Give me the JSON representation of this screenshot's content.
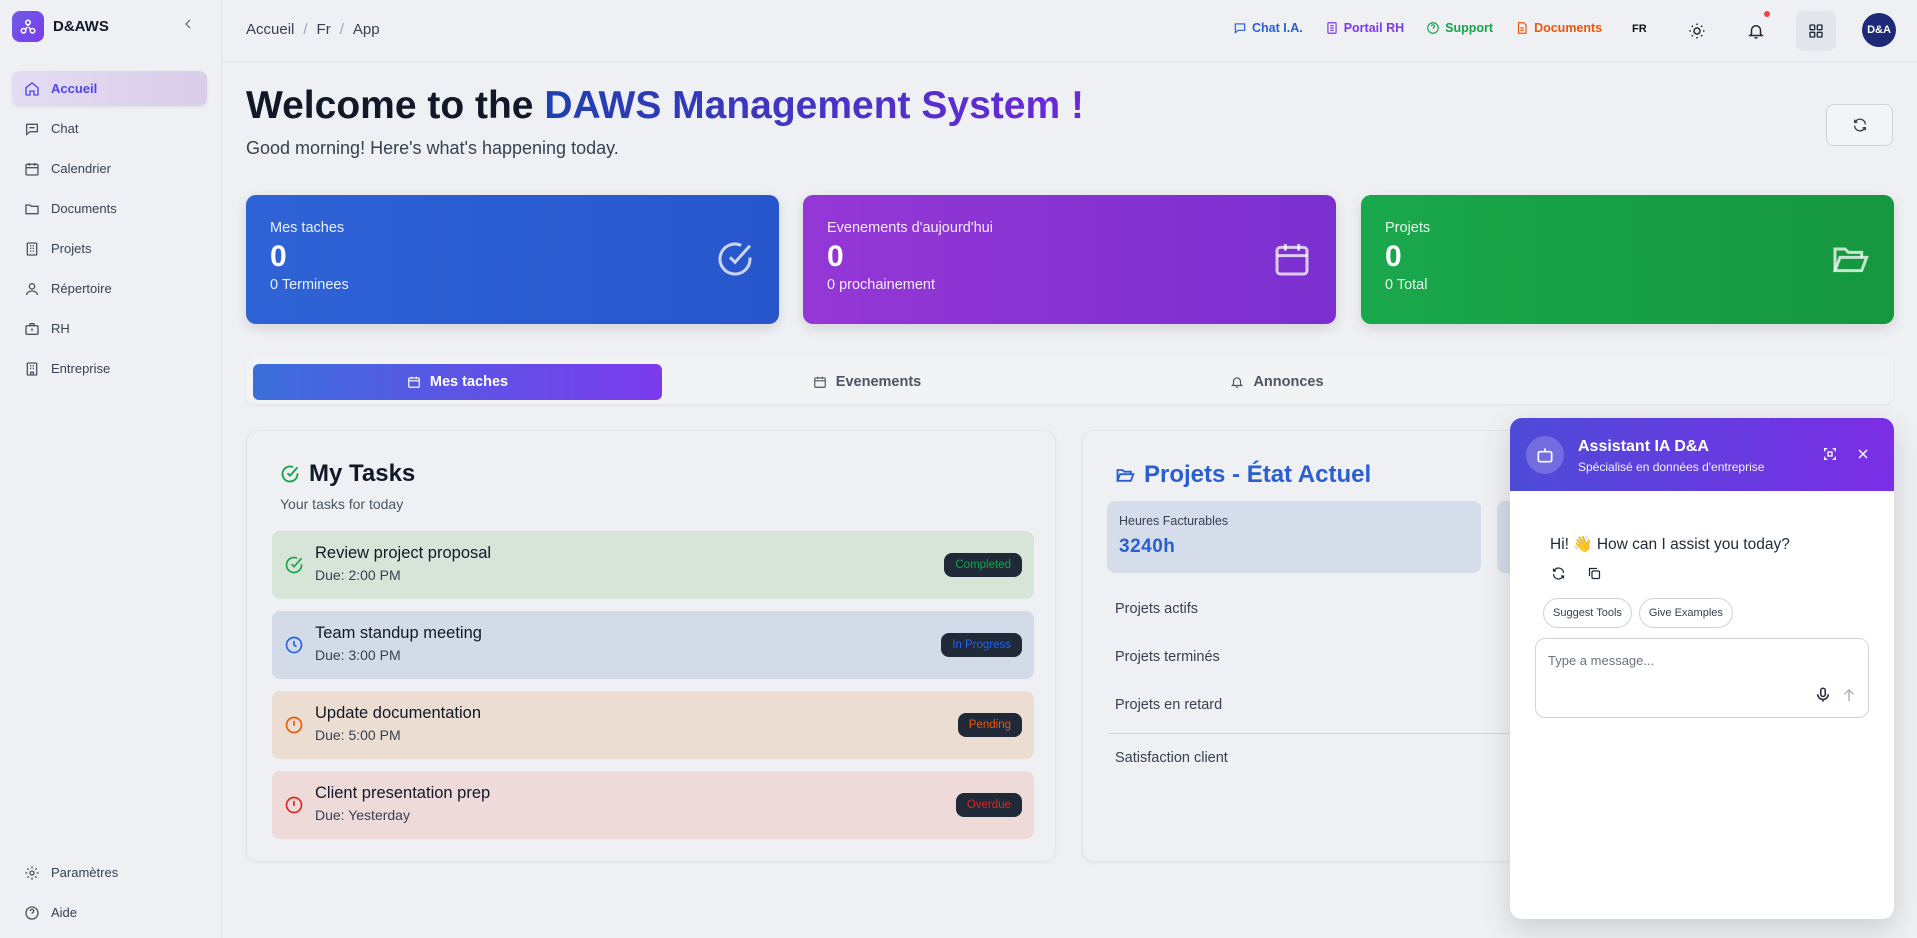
{
  "brand": {
    "name": "D&AWS"
  },
  "sidebar": {
    "items": [
      {
        "label": "Accueil",
        "icon": "home-icon",
        "active": true
      },
      {
        "label": "Chat",
        "icon": "chat-icon"
      },
      {
        "label": "Calendrier",
        "icon": "calendar-icon"
      },
      {
        "label": "Documents",
        "icon": "folder-icon"
      },
      {
        "label": "Projets",
        "icon": "building-icon"
      },
      {
        "label": "Répertoire",
        "icon": "user-icon"
      },
      {
        "label": "RH",
        "icon": "briefcase-icon"
      },
      {
        "label": "Entreprise",
        "icon": "building-icon"
      }
    ],
    "bottom": [
      {
        "label": "Paramètres",
        "icon": "gear-icon"
      },
      {
        "label": "Aide",
        "icon": "help-icon"
      }
    ]
  },
  "header": {
    "breadcrumb": [
      "Accueil",
      "Fr",
      "App"
    ],
    "links": [
      {
        "label": "Chat I.A.",
        "color": "#2b5fd1",
        "icon": "chat-icon"
      },
      {
        "label": "Portail RH",
        "color": "#7c3aed",
        "icon": "document-icon"
      },
      {
        "label": "Support",
        "color": "#16a34a",
        "icon": "help-icon"
      },
      {
        "label": "Documents",
        "color": "#ea580c",
        "icon": "file-icon"
      }
    ],
    "lang": "FR",
    "avatar": "D&A"
  },
  "welcome": {
    "title_prefix": "Welcome to the ",
    "title_highlight": "DAWS Management System !",
    "subtitle": "Good morning! Here's what's happening today."
  },
  "stats": [
    {
      "label": "Mes taches",
      "value": "0",
      "sub": "0 Terminees",
      "icon": "check-circle-icon"
    },
    {
      "label": "Evenements d'aujourd'hui",
      "value": "0",
      "sub": "0 prochainement",
      "icon": "calendar-icon"
    },
    {
      "label": "Projets",
      "value": "0",
      "sub": "0 Total",
      "icon": "folder-open-icon"
    }
  ],
  "tabs": [
    {
      "label": "Mes taches",
      "active": true
    },
    {
      "label": "Evenements"
    },
    {
      "label": "Annonces"
    }
  ],
  "tasks": {
    "title": "My Tasks",
    "subtitle": "Your tasks for today",
    "items": [
      {
        "name": "Review project proposal",
        "due": "Due: 2:00 PM",
        "status": "Completed",
        "status_color": "#16a34a",
        "icon_color": "#16a34a"
      },
      {
        "name": "Team standup meeting",
        "due": "Due: 3:00 PM",
        "status": "In Progress",
        "status_color": "#2563eb",
        "icon_color": "#2563eb"
      },
      {
        "name": "Update documentation",
        "due": "Due: 5:00 PM",
        "status": "Pending",
        "status_color": "#ea580c",
        "icon_color": "#ea580c"
      },
      {
        "name": "Client presentation prep",
        "due": "Due: Yesterday",
        "status": "Overdue",
        "status_color": "#dc2626",
        "icon_color": "#dc2626"
      }
    ]
  },
  "projects": {
    "title": "Projets - État Actuel",
    "kpi_label": "Heures Facturables",
    "kpi_value": "3240h",
    "rows": [
      "Projets actifs",
      "Projets terminés",
      "Projets en retard",
      "Satisfaction client"
    ]
  },
  "assistant": {
    "title": "Assistant IA D&A",
    "subtitle": "Spécialisé en données d'entreprise",
    "message": "Hi! 👋 How can I assist you today?",
    "chips": [
      "Suggest Tools",
      "Give Examples"
    ],
    "input_placeholder": "Type a message..."
  }
}
